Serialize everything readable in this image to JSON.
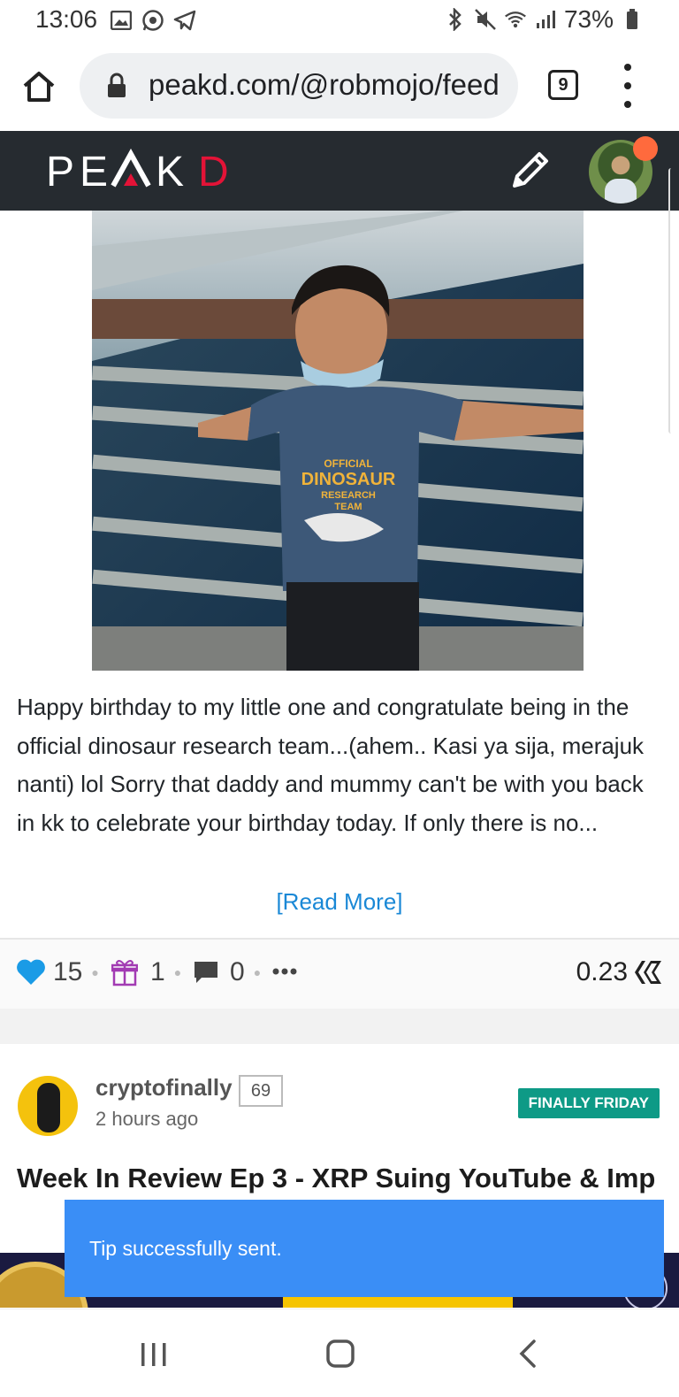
{
  "status_bar": {
    "time": "13:06",
    "battery": "73%",
    "icons_left": [
      "gallery-icon",
      "whatsapp-icon",
      "telegram-icon"
    ],
    "icons_right": [
      "bluetooth-icon",
      "mute-icon",
      "wifi-icon",
      "signal-icon",
      "battery-icon"
    ]
  },
  "browser": {
    "url": "peakd.com/@robmojo/feed",
    "tab_count": "9"
  },
  "header": {
    "logo_text": "PEAKD",
    "brand_accent": "#e31337",
    "notification_color": "#ff6a3d"
  },
  "post": {
    "body": "Happy birthday to my little one and congratulate being in the official dinosaur research team...(ahem.. Kasi ya sija, merajuk nanti) lol Sorry that daddy and mummy can't be with you back in kk to celebrate your birthday today. If only there is no...",
    "read_more": "[Read More]",
    "votes": "15",
    "tips": "1",
    "comments": "0",
    "payout": "0.23",
    "image_shirt_text": [
      "OFFICIAL",
      "DINOSAUR",
      "RESEARCH",
      "TEAM"
    ]
  },
  "next_post": {
    "author": "cryptofinally",
    "reputation": "69",
    "time": "2 hours ago",
    "tag": "FINALLY FRIDAY",
    "title": "Week In Review Ep 3 - XRP Suing YouTube & Imp"
  },
  "toast": {
    "message": "Tip successfully sent."
  },
  "colors": {
    "upvote": "#1a9be6",
    "tip": "#a23bb3",
    "link": "#1a88d6",
    "tag_bg": "#0e9a86",
    "toast_bg": "#3a8ef6"
  }
}
